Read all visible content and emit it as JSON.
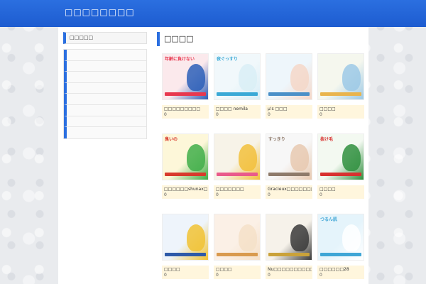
{
  "site": {
    "title": "□□□□□□□□"
  },
  "sidebar": {
    "heading": "□□□□□",
    "items": [
      "",
      "",
      "",
      "",
      "",
      "",
      "",
      ""
    ]
  },
  "main": {
    "heading": "□□□□",
    "items": [
      {
        "title": "□□□□□□□□□",
        "count": "0",
        "colors": [
          "#fbe9ec",
          "#e8384f",
          "#2c5fb8"
        ],
        "thumb_text": "年齢に負けない"
      },
      {
        "title": "□□□□ nemila",
        "count": "0",
        "colors": [
          "#f1f8fb",
          "#3aa9d6",
          "#d9eef6"
        ],
        "thumb_text": "夜ぐっすり"
      },
      {
        "title": "μ's □□□",
        "count": "0",
        "colors": [
          "#eef6fb",
          "#4a90c8",
          "#f5d7c8"
        ],
        "thumb_text": ""
      },
      {
        "title": "□□□□",
        "count": "0",
        "colors": [
          "#f5f7ee",
          "#e9b44c",
          "#9cc9e6"
        ],
        "thumb_text": ""
      },
      {
        "title": "□□□□□□shunax□",
        "count": "0",
        "colors": [
          "#fdf7d9",
          "#d83a2c",
          "#3fae49"
        ],
        "thumb_text": "臭いの"
      },
      {
        "title": "□□□□□□□",
        "count": "0",
        "colors": [
          "#f7f3e8",
          "#e95a8b",
          "#f2c03b"
        ],
        "thumb_text": ""
      },
      {
        "title": "Gracieux□□□□□□□",
        "count": "0",
        "colors": [
          "#f7f7f7",
          "#8e7a6a",
          "#e8c9b0"
        ],
        "thumb_text": "すっきり"
      },
      {
        "title": "□□□□",
        "count": "0",
        "colors": [
          "#f3f9f1",
          "#d8312f",
          "#2f8f3e"
        ],
        "thumb_text": "抜け毛"
      },
      {
        "title": "□□□□",
        "count": "0",
        "colors": [
          "#eef4fb",
          "#2e5aa8",
          "#f1c232"
        ],
        "thumb_text": ""
      },
      {
        "title": "□□□□",
        "count": "0",
        "colors": [
          "#fbf0e6",
          "#d99a4e",
          "#f5e0c8"
        ],
        "thumb_text": ""
      },
      {
        "title": "Nu□□□□□□□□□□□",
        "count": "0",
        "colors": [
          "#f6f2ea",
          "#caa23a",
          "#3a3a3a"
        ],
        "thumb_text": ""
      },
      {
        "title": "□□□□□□28",
        "count": "0",
        "colors": [
          "#e5f4fb",
          "#3fa6d6",
          "#ffffff"
        ],
        "thumb_text": "つるん肌"
      }
    ]
  }
}
